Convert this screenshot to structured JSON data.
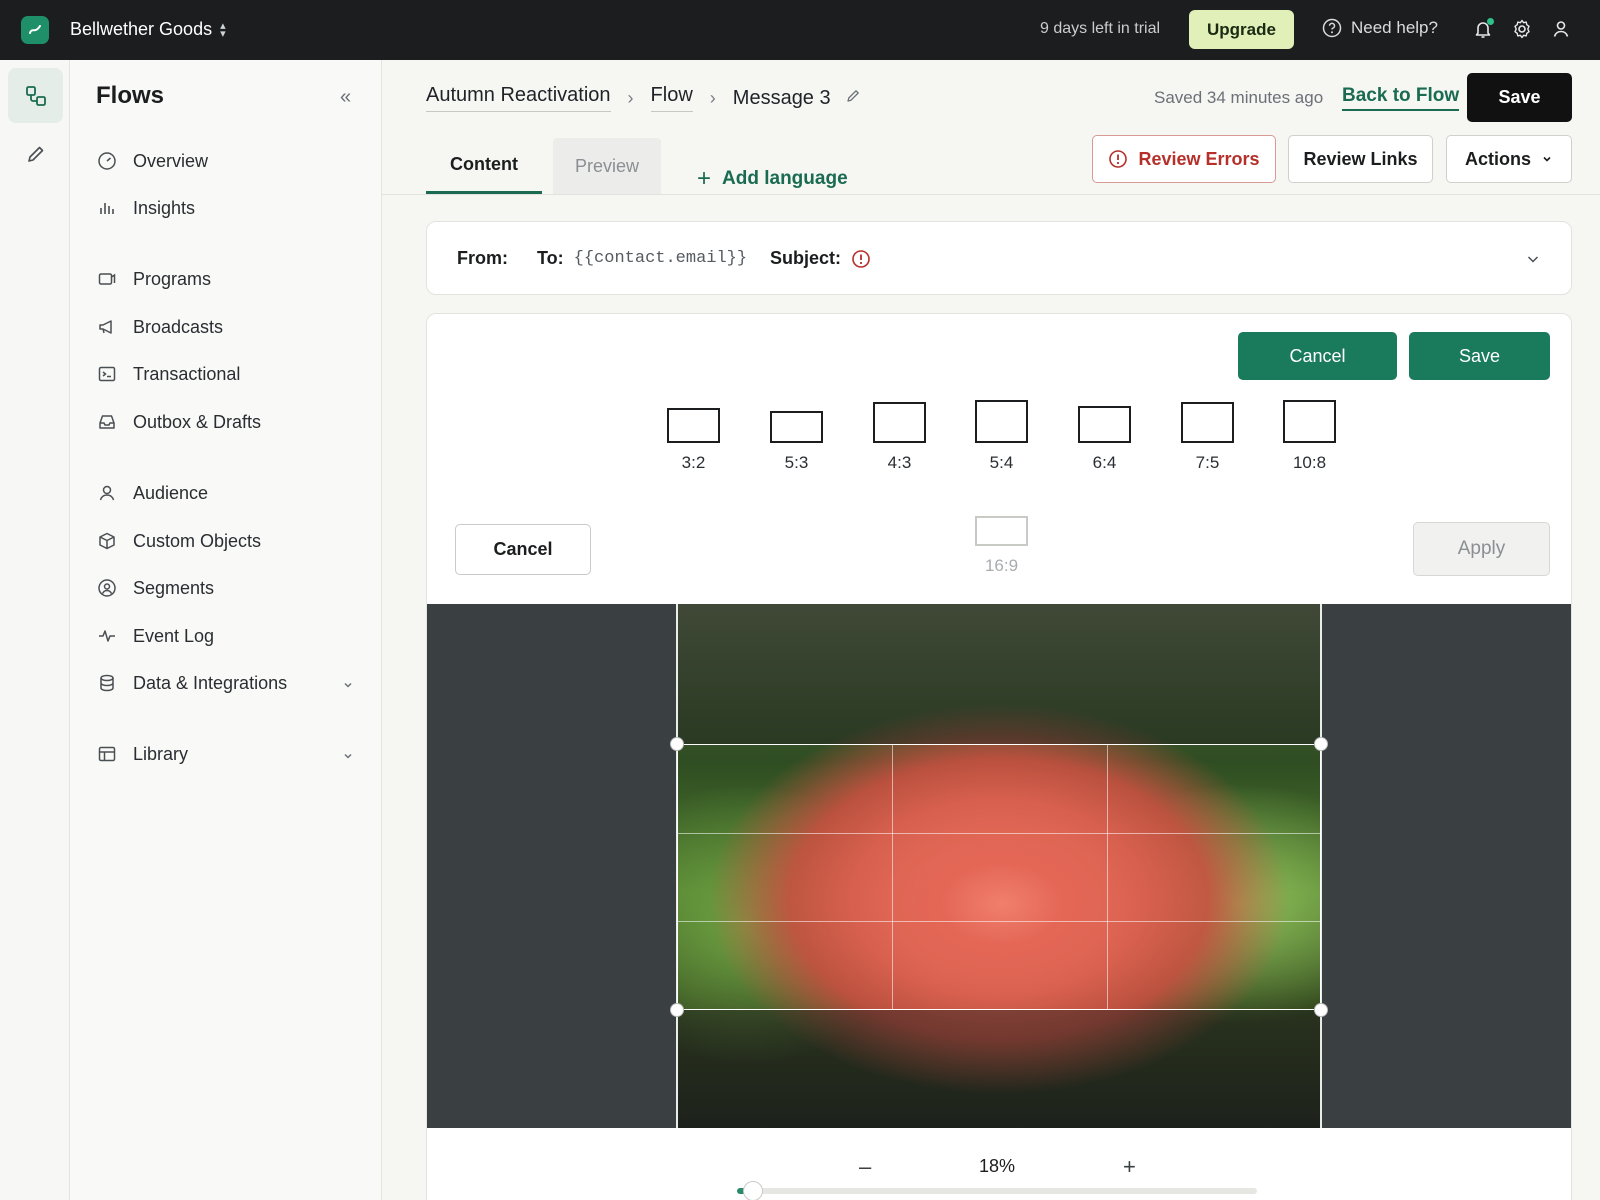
{
  "topbar": {
    "brand": "Bellwether Goods",
    "trial_text": "9 days left in trial",
    "upgrade_label": "Upgrade",
    "help_label": "Need help?"
  },
  "sidebar": {
    "title": "Flows",
    "items": [
      {
        "label": "Overview",
        "icon": "gauge-icon"
      },
      {
        "label": "Insights",
        "icon": "bar-chart-icon"
      },
      {
        "label": "Programs",
        "icon": "programs-icon"
      },
      {
        "label": "Broadcasts",
        "icon": "megaphone-icon"
      },
      {
        "label": "Transactional",
        "icon": "terminal-icon"
      },
      {
        "label": "Outbox & Drafts",
        "icon": "inbox-icon"
      },
      {
        "label": "Audience",
        "icon": "person-icon"
      },
      {
        "label": "Custom Objects",
        "icon": "cube-icon"
      },
      {
        "label": "Segments",
        "icon": "user-circle-icon"
      },
      {
        "label": "Event Log",
        "icon": "pulse-icon"
      },
      {
        "label": "Data & Integrations",
        "icon": "database-icon"
      },
      {
        "label": "Library",
        "icon": "library-icon"
      }
    ]
  },
  "header": {
    "breadcrumbs": [
      "Autumn Reactivation",
      "Flow",
      "Message 3"
    ],
    "saved_text": "Saved 34 minutes ago",
    "back_label": "Back to Flow",
    "save_label": "Save",
    "tabs": [
      "Content",
      "Preview"
    ],
    "add_language": "Add language",
    "review_errors": "Review Errors",
    "review_links": "Review Links",
    "actions": "Actions"
  },
  "envelope": {
    "from_label": "From:",
    "to_label": "To:",
    "to_value": "{{contact.email}}",
    "subject_label": "Subject:"
  },
  "editor": {
    "cancel_label": "Cancel",
    "save_label": "Save",
    "ratios": [
      "3:2",
      "5:3",
      "4:3",
      "5:4",
      "6:4",
      "7:5",
      "10:8",
      "16:9"
    ],
    "crop_cancel_label": "Cancel",
    "apply_label": "Apply",
    "zoom_minus": "–",
    "zoom_plus": "+",
    "zoom_value": "18%",
    "zoom_fraction": 0.03
  },
  "colors": {
    "accent": "#1a7a5c",
    "link": "#1a6b52",
    "error": "#b5302a",
    "topbar": "#1b1d1e",
    "upgrade_bg": "#e1f0b9"
  }
}
